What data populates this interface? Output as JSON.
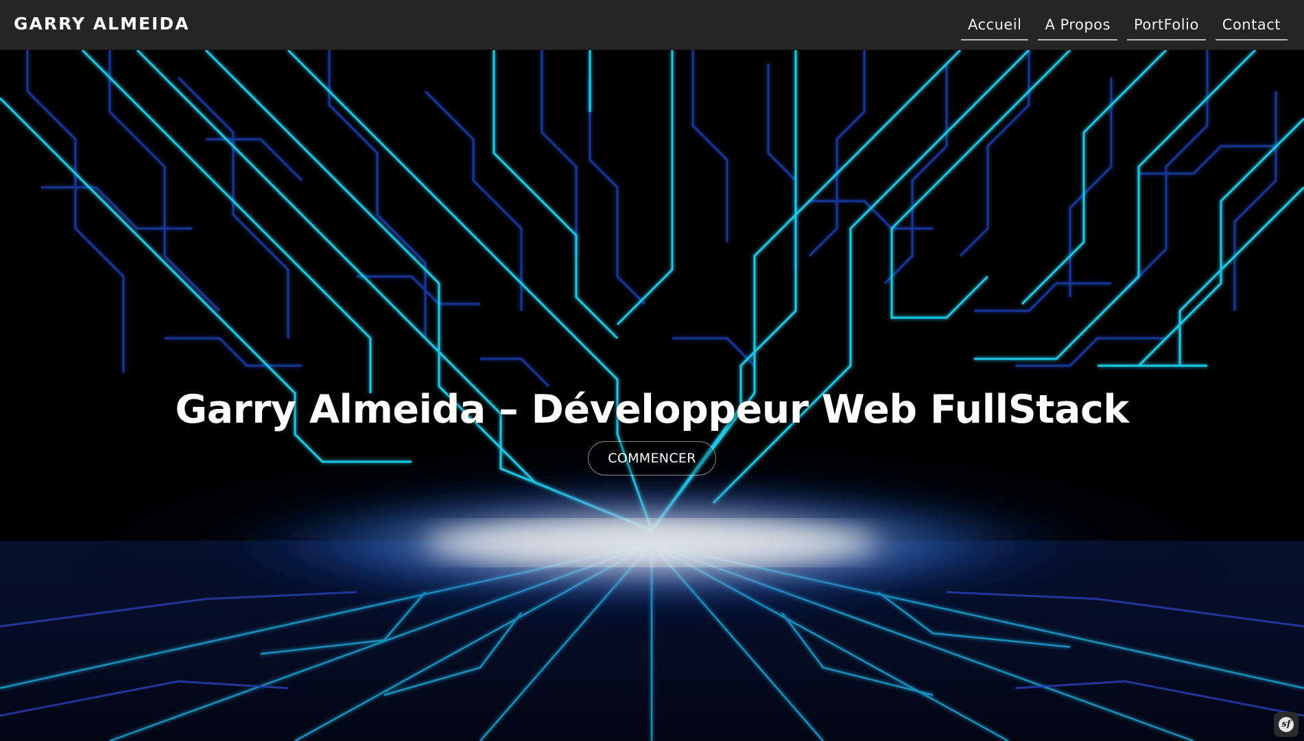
{
  "navbar": {
    "brand": "GARRY ALMEIDA",
    "links": [
      {
        "label": "Accueil"
      },
      {
        "label": "A Propos"
      },
      {
        "label": "PortFolio"
      },
      {
        "label": "Contact"
      }
    ]
  },
  "hero": {
    "title": "Garry Almeida – Développeur Web FullStack",
    "cta_label": "COMMENCER"
  },
  "debug_toolbar": {
    "icon": "symfony-logo-icon",
    "glyph": "sf"
  },
  "colors": {
    "navbar_bg": "#252525",
    "circuit_cyan": "#1ec8e6",
    "circuit_blue": "#2a4fd0",
    "glow": "#e9eef5"
  }
}
